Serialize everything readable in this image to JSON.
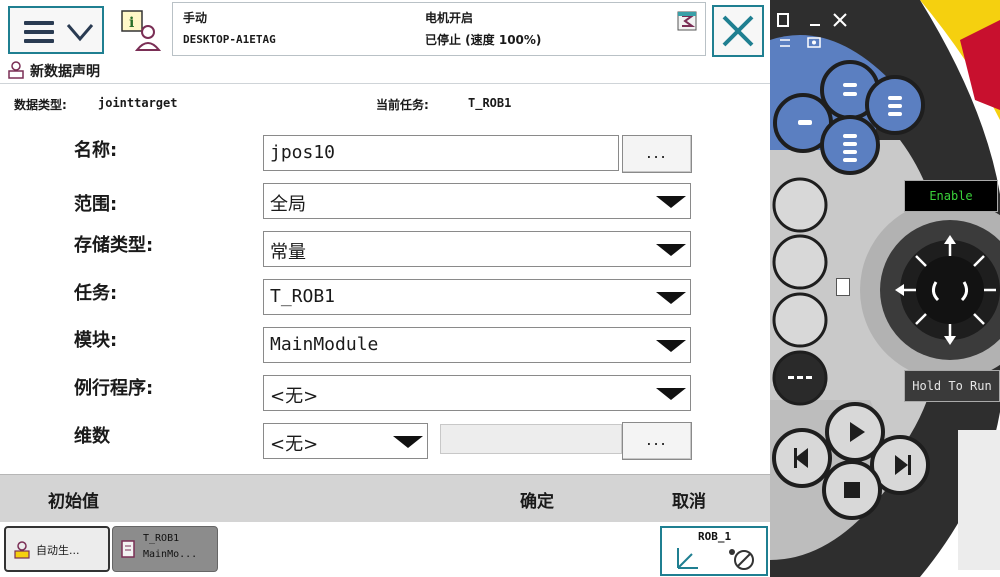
{
  "header": {
    "operating_mode": "手动",
    "host_name": "DESKTOP-A1ETAG",
    "motor_state": "电机开启",
    "run_state": "已停止 (速度 100%)"
  },
  "page": {
    "title": "新数据声明",
    "data_type_label": "数据类型:",
    "data_type_value": "jointtarget",
    "current_task_label": "当前任务:",
    "current_task_value": "T_ROB1"
  },
  "form": {
    "name_label": "名称:",
    "name_value": "jpos10",
    "name_browse": "...",
    "scope_label": "范围:",
    "scope_value": "全局",
    "storage_label": "存储类型:",
    "storage_value": "常量",
    "task_label": "任务:",
    "task_value": "T_ROB1",
    "module_label": "模块:",
    "module_value": "MainModule",
    "routine_label": "例行程序:",
    "routine_value": "<无>",
    "dimension_label": "维数",
    "dimension_value": "<无>",
    "dimension_browse": "..."
  },
  "bottom_bar": {
    "initial_value": "初始值",
    "ok": "确定",
    "cancel": "取消"
  },
  "taskbar": {
    "auto_item": "自动生...",
    "rob_line1": "T_ROB1",
    "rob_line2": "MainMo...",
    "robot_status_label": "ROB_1"
  },
  "pendant": {
    "enable": "Enable",
    "hold_to_run": "Hold To Run",
    "colors": {
      "accent_blue": "#5b7fc1",
      "body_gray": "#2e2e2e",
      "button_gray": "#c9c9c9",
      "yellow": "#f5d00f",
      "red": "#c8102e"
    }
  }
}
